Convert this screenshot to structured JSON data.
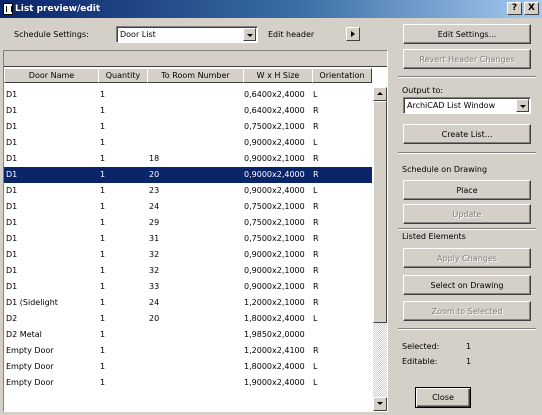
{
  "window": {
    "title": "List preview/edit",
    "help_btn": "?",
    "close_btn": "X"
  },
  "toolbar": {
    "schedule_label": "Schedule Settings:",
    "schedule_value": "Door List",
    "edit_header_label": "Edit header"
  },
  "table": {
    "columns": [
      "Door Name",
      "Quantity",
      "To Room Number",
      "W x H Size",
      "Orientation"
    ],
    "selected_index": 5,
    "rows": [
      {
        "name": "D1",
        "qty": "1",
        "room": "",
        "size": "0,6400x2,4000",
        "orient": "L"
      },
      {
        "name": "D1",
        "qty": "1",
        "room": "",
        "size": "0,6400x2,4000",
        "orient": "R"
      },
      {
        "name": "D1",
        "qty": "1",
        "room": "",
        "size": "0,7500x2,1000",
        "orient": "R"
      },
      {
        "name": "D1",
        "qty": "1",
        "room": "",
        "size": "0,9000x2,4000",
        "orient": "L"
      },
      {
        "name": "D1",
        "qty": "1",
        "room": "18",
        "size": "0,9000x2,1000",
        "orient": "R"
      },
      {
        "name": "D1",
        "qty": "1",
        "room": "20",
        "size": "0,9000x2,4000",
        "orient": "R"
      },
      {
        "name": "D1",
        "qty": "1",
        "room": "23",
        "size": "0,9000x2,4000",
        "orient": "L"
      },
      {
        "name": "D1",
        "qty": "1",
        "room": "24",
        "size": "0,7500x2,1000",
        "orient": "R"
      },
      {
        "name": "D1",
        "qty": "1",
        "room": "29",
        "size": "0,7500x2,1000",
        "orient": "R"
      },
      {
        "name": "D1",
        "qty": "1",
        "room": "31",
        "size": "0,7500x2,1000",
        "orient": "R"
      },
      {
        "name": "D1",
        "qty": "1",
        "room": "32",
        "size": "0,9000x2,1000",
        "orient": "R"
      },
      {
        "name": "D1",
        "qty": "1",
        "room": "32",
        "size": "0,9000x2,1000",
        "orient": "R"
      },
      {
        "name": "D1",
        "qty": "1",
        "room": "33",
        "size": "0,9000x2,1000",
        "orient": "R"
      },
      {
        "name": "D1 (Sidelight",
        "qty": "1",
        "room": "24",
        "size": "1,2000x2,1000",
        "orient": "R"
      },
      {
        "name": "D2",
        "qty": "1",
        "room": "20",
        "size": "1,8000x2,4000",
        "orient": "L"
      },
      {
        "name": "D2 Metal",
        "qty": "1",
        "room": "",
        "size": "1,9850x2,0000",
        "orient": ""
      },
      {
        "name": "Empty Door",
        "qty": "1",
        "room": "",
        "size": "1,2000x2,4100",
        "orient": "R"
      },
      {
        "name": "Empty Door",
        "qty": "1",
        "room": "",
        "size": "1,8000x2,4000",
        "orient": "L"
      },
      {
        "name": "Empty Door",
        "qty": "1",
        "room": "",
        "size": "1,9000x2,4000",
        "orient": "L"
      }
    ]
  },
  "side": {
    "edit_settings": "Edit Settings...",
    "revert_header": "Revert Header Changes",
    "output_label": "Output to:",
    "output_value": "ArchiCAD List Window",
    "create_list": "Create List...",
    "schedule_drawing_label": "Schedule on Drawing",
    "place": "Place",
    "update": "Update",
    "listed_label": "Listed Elements",
    "apply_changes": "Apply Changes",
    "select_on_drawing": "Select on Drawing",
    "zoom_to_selected": "Zoom to Selected",
    "selected_label": "Selected:",
    "selected_value": "1",
    "editable_label": "Editable:",
    "editable_value": "1",
    "close": "Close"
  },
  "colors": {
    "selection": "#0a246a",
    "face": "#d4d0c8"
  }
}
